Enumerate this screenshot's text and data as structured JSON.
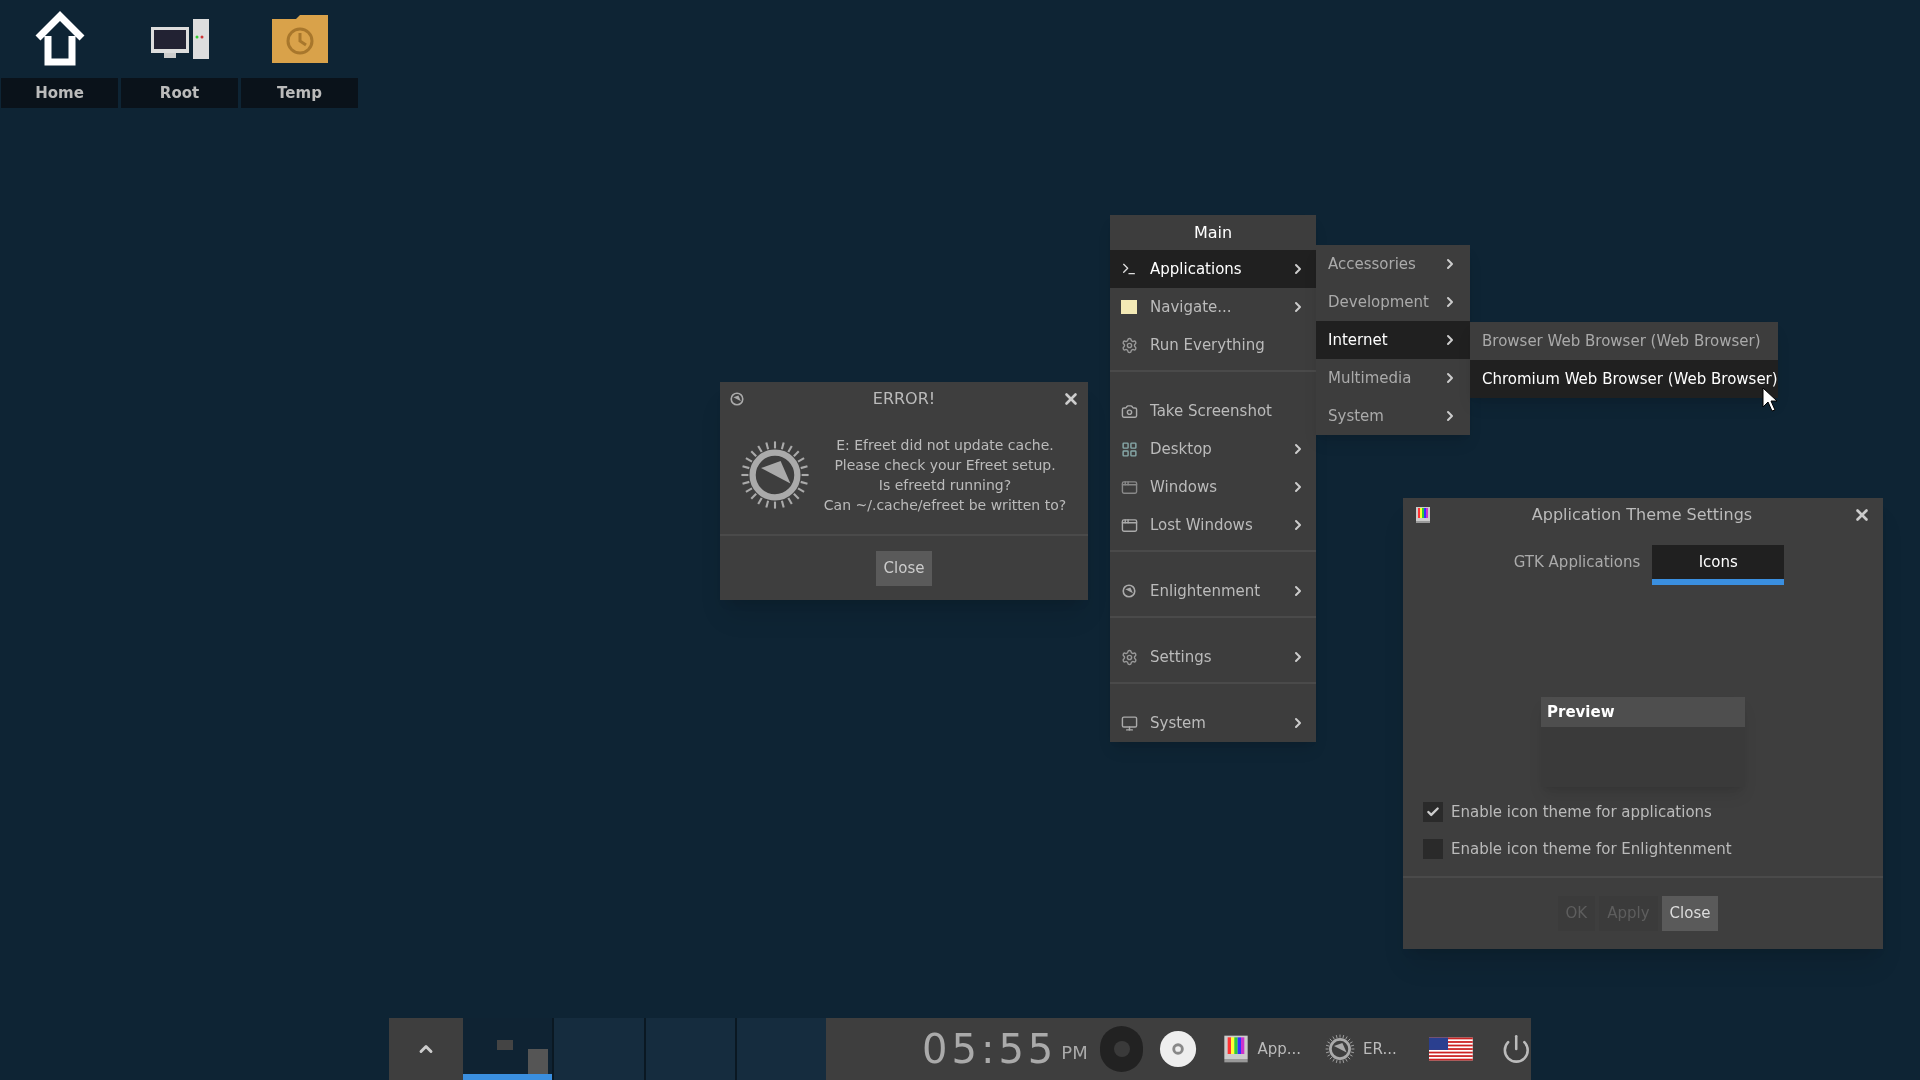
{
  "desktop_icons": [
    {
      "label": "Home"
    },
    {
      "label": "Root"
    },
    {
      "label": "Temp"
    }
  ],
  "main_menu": {
    "title": "Main",
    "sections": [
      [
        {
          "label": "Applications",
          "submenu": true,
          "selected": true
        },
        {
          "label": "Navigate...",
          "submenu": true,
          "selected": false
        },
        {
          "label": "Run Everything",
          "submenu": false,
          "selected": false
        }
      ],
      [
        {
          "label": "Take Screenshot",
          "submenu": false,
          "selected": false
        },
        {
          "label": "Desktop",
          "submenu": true,
          "selected": false
        },
        {
          "label": "Windows",
          "submenu": true,
          "selected": false
        },
        {
          "label": "Lost Windows",
          "submenu": true,
          "selected": false
        }
      ],
      [
        {
          "label": "Enlightenment",
          "submenu": true,
          "selected": false
        }
      ],
      [
        {
          "label": "Settings",
          "submenu": true,
          "selected": false
        }
      ],
      [
        {
          "label": "System",
          "submenu": true,
          "selected": false
        }
      ]
    ]
  },
  "applications_menu": {
    "items": [
      {
        "label": "Accessories",
        "selected": false
      },
      {
        "label": "Development",
        "selected": false
      },
      {
        "label": "Internet",
        "selected": true
      },
      {
        "label": "Multimedia",
        "selected": false
      },
      {
        "label": "System",
        "selected": false
      }
    ]
  },
  "internet_menu": {
    "items": [
      {
        "label": "Browser Web Browser (Web Browser)",
        "selected": false
      },
      {
        "label": "Chromium Web Browser (Web Browser)",
        "selected": true
      }
    ]
  },
  "error_dialog": {
    "title": "ERROR!",
    "message_lines": [
      "E: Efreet did not update cache.",
      "Please check your Efreet setup.",
      "Is efreetd running?",
      "Can ~/.cache/efreet be written to?"
    ],
    "button": "Close"
  },
  "theme_dialog": {
    "title": "Application Theme Settings",
    "tabs": [
      {
        "label": "GTK Applications",
        "selected": false
      },
      {
        "label": "Icons",
        "selected": true
      }
    ],
    "preview_title": "Preview",
    "checkboxes": [
      {
        "label": "Enable icon theme for applications",
        "checked": true
      },
      {
        "label": "Enable icon theme for Enlightenment",
        "checked": false
      }
    ],
    "buttons": [
      {
        "label": "OK",
        "disabled": true
      },
      {
        "label": "Apply",
        "disabled": true
      },
      {
        "label": "Close",
        "disabled": false
      }
    ]
  },
  "taskbar": {
    "desks": [
      {
        "selected": true
      },
      {
        "selected": false
      },
      {
        "selected": false
      },
      {
        "selected": false
      }
    ],
    "clock": "05:55",
    "ampm": "PM",
    "tasks": [
      {
        "label": "App..."
      },
      {
        "label": "ER..."
      }
    ]
  }
}
